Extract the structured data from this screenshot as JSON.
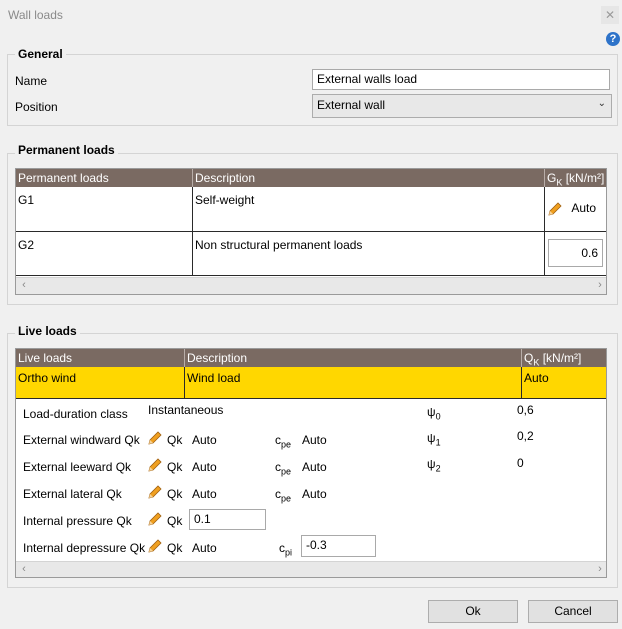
{
  "window": {
    "title": "Wall loads"
  },
  "general": {
    "title": "General",
    "name_label": "Name",
    "name_value": "External walls load",
    "position_label": "Position",
    "position_value": "External wall"
  },
  "permanent": {
    "title": "Permanent loads",
    "headers": {
      "col1": "Permanent loads",
      "col2": "Description",
      "col3_main": "G",
      "col3_sub": "K",
      "col3_unit": " [kN/m²]"
    },
    "rows": [
      {
        "name": "G1",
        "description": "Self-weight",
        "value": "Auto"
      },
      {
        "name": "G2",
        "description": "Non structural permanent loads",
        "value": "0.6"
      }
    ]
  },
  "live": {
    "title": "Live loads",
    "headers": {
      "col1": "Live loads",
      "col2": "Description",
      "col3_main": "Q",
      "col3_sub": "K",
      "col3_unit": " [kN/m²]"
    },
    "row": {
      "name": "Ortho wind",
      "description": "Wind load",
      "value": "Auto"
    },
    "details": {
      "duration_label": "Load-duration class",
      "duration_value": "Instantaneous",
      "windward_label": "External windward Qk",
      "leeward_label": "External leeward Qk",
      "lateral_label": "External lateral Qk",
      "int_pressure_label": "Internal pressure Qk",
      "int_depressure_label": "Internal depressure Qk",
      "qk_label": "Qk",
      "auto": "Auto",
      "int_pressure_value": "0.1",
      "cpe_main": "c",
      "cpe_sub": "pe",
      "cpi_main": "c",
      "cpi_sub": "pi",
      "cpi_value": "-0.3",
      "psi0_main": "ψ",
      "psi0_sub": "0",
      "psi0_value": "0,6",
      "psi1_main": "ψ",
      "psi1_sub": "1",
      "psi1_value": "0,2",
      "psi2_main": "ψ",
      "psi2_sub": "2",
      "psi2_value": "0"
    }
  },
  "buttons": {
    "ok": "Ok",
    "cancel": "Cancel"
  },
  "colors": {
    "grid_header": "#7a6a62",
    "selected_row": "#ffd700",
    "help_icon": "#2e73c9"
  },
  "icons": {
    "edit": "pencil-icon",
    "help": "question-icon",
    "close": "close-icon"
  }
}
